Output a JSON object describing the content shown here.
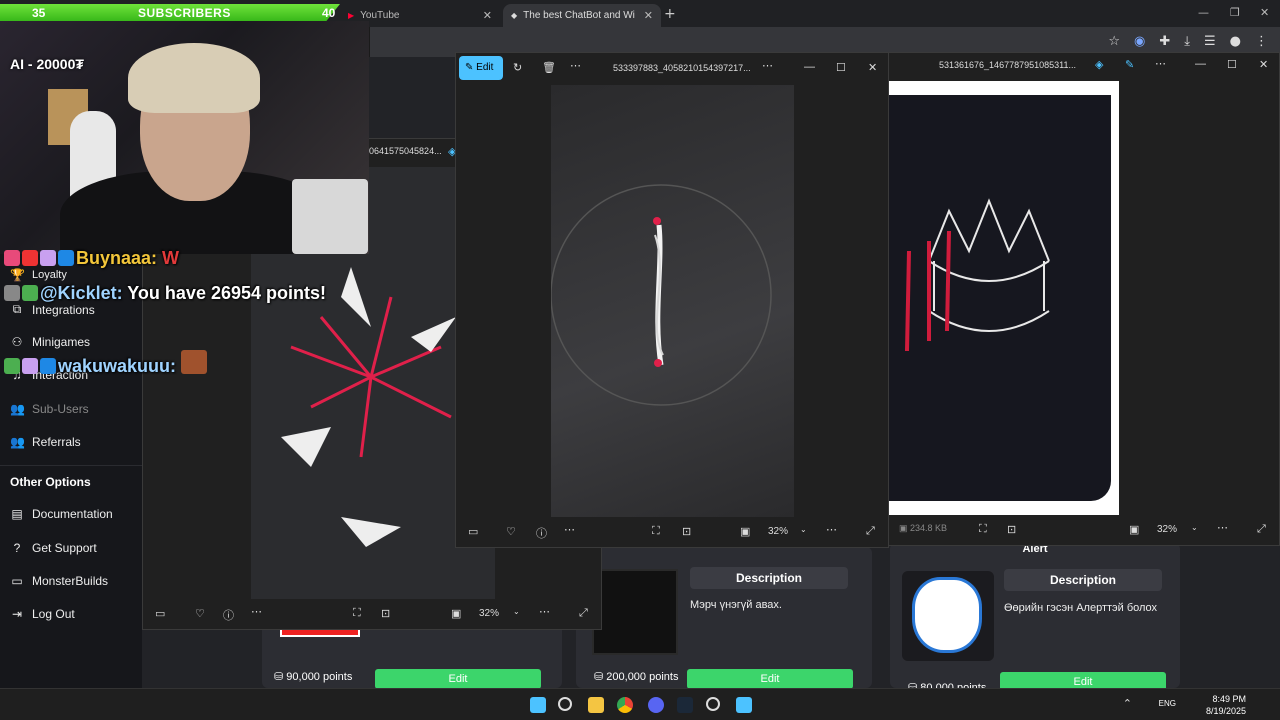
{
  "stream_overlay": {
    "subscriber_count": "35",
    "subscriber_label": "SUBSCRIBERS",
    "subscriber_goal": "40",
    "webcam_label": "AI - 20000₮"
  },
  "browser": {
    "tabs": [
      {
        "label": "YouTube",
        "icon": "youtube-icon"
      },
      {
        "label": "The best ChatBot and Widgets",
        "icon": "botrix-icon"
      }
    ]
  },
  "chat": [
    {
      "user": "Buynaaa:",
      "message": "W"
    },
    {
      "user": "@Kicklet:",
      "message": "You have 26954 points!"
    },
    {
      "user": "wakuwakuuu:",
      "message": ""
    }
  ],
  "sidebar": {
    "items": [
      {
        "label": "Loyalty",
        "icon": "trophy-icon"
      },
      {
        "label": "Integrations",
        "icon": "plug-icon"
      },
      {
        "label": "Minigames",
        "icon": "gamepad-icon"
      },
      {
        "label": "Interaction",
        "icon": "music-icon"
      },
      {
        "label": "Sub-Users",
        "icon": "users-icon"
      },
      {
        "label": "Referrals",
        "icon": "users-icon"
      }
    ],
    "heading": "Other Options",
    "options": [
      {
        "label": "Documentation",
        "icon": "book-icon"
      },
      {
        "label": "Get Support",
        "icon": "help-icon"
      },
      {
        "label": "MonsterBuilds",
        "icon": "monitor-icon"
      },
      {
        "label": "Log Out",
        "icon": "logout-icon"
      }
    ]
  },
  "store": {
    "items": [
      {
        "points": "90,000 points",
        "description_heading": "",
        "description": "",
        "edit_label": "Edit"
      },
      {
        "points": "200,000 points",
        "description_heading": "Description",
        "description": "Мэрч үнэгүй авах.",
        "edit_label": "Edit"
      },
      {
        "points": "80,000 points",
        "description_heading": "Description",
        "description": "Өөрийн гэсэн Алерттэй болох",
        "edit_label": "Edit",
        "title": "Alert"
      }
    ]
  },
  "viewers": [
    {
      "filename": "0641575045824...",
      "zoom": "32%"
    },
    {
      "filename": "533397883_4058210154397217...",
      "zoom": "32%",
      "edit_label": "Edit"
    },
    {
      "filename": "531361676_1467787951085311...",
      "zoom": "32%",
      "file_size": "234.8 KB"
    }
  ],
  "taskbar": {
    "language": "ENG",
    "time": "8:49 PM",
    "date": "8/19/2025"
  },
  "colors": {
    "sub_bar": "#4fd12a",
    "edit_button": "#3cd56b",
    "accent_blue": "#4cc2ff"
  }
}
